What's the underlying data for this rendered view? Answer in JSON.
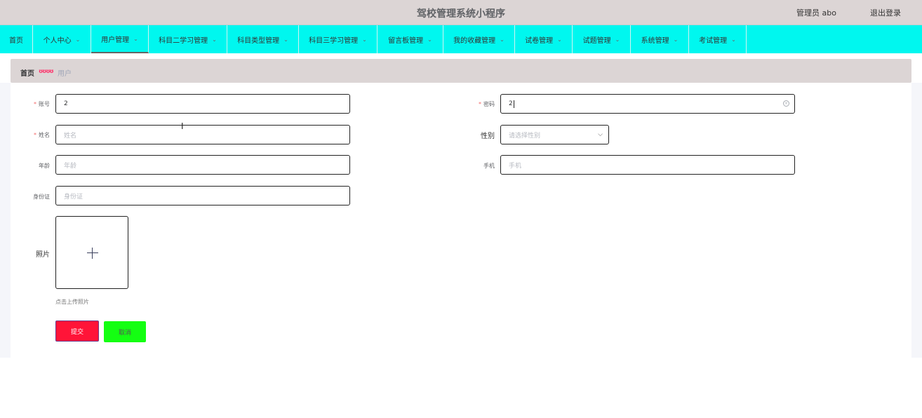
{
  "header": {
    "title": "驾校管理系统小程序",
    "admin_label": "管理员 abo",
    "logout_label": "退出登录"
  },
  "nav": {
    "items": [
      {
        "label": "首页",
        "dropdown": false
      },
      {
        "label": "个人中心",
        "dropdown": true
      },
      {
        "label": "用户管理",
        "dropdown": true,
        "active": true
      },
      {
        "label": "科目二学习管理",
        "dropdown": true
      },
      {
        "label": "科目类型管理",
        "dropdown": true
      },
      {
        "label": "科目三学习管理",
        "dropdown": true
      },
      {
        "label": "留言板管理",
        "dropdown": true
      },
      {
        "label": "我的收藏管理",
        "dropdown": true
      },
      {
        "label": "试卷管理",
        "dropdown": true
      },
      {
        "label": "试题管理",
        "dropdown": true
      },
      {
        "label": "系统管理",
        "dropdown": true
      },
      {
        "label": "考试管理",
        "dropdown": true
      }
    ]
  },
  "breadcrumb": {
    "home": "首页",
    "separator": "ʊʊʊʊ",
    "current": "用户"
  },
  "form": {
    "account": {
      "label": "账号",
      "value": "2",
      "required": true
    },
    "password": {
      "label": "密码",
      "value": "2",
      "required": true
    },
    "name": {
      "label": "姓名",
      "placeholder": "姓名",
      "required": true
    },
    "gender": {
      "label": "性别",
      "placeholder": "请选择性别"
    },
    "age": {
      "label": "年龄",
      "placeholder": "年龄"
    },
    "phone": {
      "label": "手机",
      "placeholder": "手机"
    },
    "id_card": {
      "label": "身份证",
      "placeholder": "身份证"
    },
    "photo": {
      "label": "照片",
      "hint": "点击上传照片"
    }
  },
  "actions": {
    "submit_label": "提交",
    "cancel_label": "取消"
  },
  "colors": {
    "nav_bg": "#00f7ef",
    "header_bg": "#dcd5d5",
    "submit_bg": "#ff1438",
    "cancel_bg": "#14ff12"
  }
}
